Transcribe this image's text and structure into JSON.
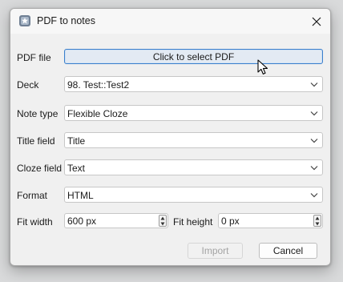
{
  "window": {
    "title": "PDF to notes",
    "icon": "anki-app-icon",
    "close_icon": "close-icon"
  },
  "form": {
    "pdf_file": {
      "label": "PDF file",
      "button_label": "Click to select PDF"
    },
    "deck": {
      "label": "Deck",
      "value": "98. Test::Test2"
    },
    "note_type": {
      "label": "Note type",
      "value": "Flexible Cloze"
    },
    "title_field": {
      "label": "Title field",
      "value": "Title"
    },
    "cloze_field": {
      "label": "Cloze field",
      "value": "Text"
    },
    "format": {
      "label": "Format",
      "value": "HTML"
    },
    "fit_width": {
      "label": "Fit width",
      "value": "600 px"
    },
    "fit_height": {
      "label": "Fit height",
      "value": "0 px"
    }
  },
  "buttons": {
    "import_label": "Import",
    "import_enabled": false,
    "cancel_label": "Cancel"
  },
  "colors": {
    "focus_border": "#3b7fcc",
    "focus_fill": "#e3eaf3",
    "disabled_text": "#a3a3a3"
  }
}
